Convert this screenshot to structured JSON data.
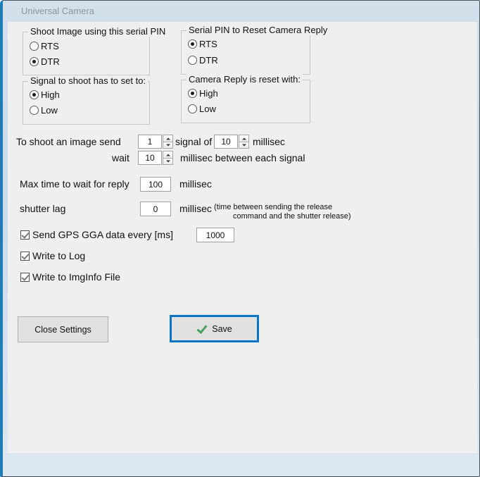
{
  "window": {
    "title": "Universal Camera"
  },
  "groups": {
    "shoot_pin": {
      "title": "Shoot Image using this serial PIN",
      "options": [
        {
          "label": "RTS",
          "selected": false
        },
        {
          "label": "DTR",
          "selected": true
        }
      ]
    },
    "reset_pin": {
      "title": "Serial PIN to Reset Camera Reply",
      "options": [
        {
          "label": "RTS",
          "selected": true
        },
        {
          "label": "DTR",
          "selected": false
        }
      ]
    },
    "signal_level": {
      "title": "Signal to shoot has to set to:",
      "options": [
        {
          "label": "High",
          "selected": true
        },
        {
          "label": "Low",
          "selected": false
        }
      ]
    },
    "reply_reset": {
      "title": "Camera Reply is reset with:",
      "options": [
        {
          "label": "High",
          "selected": true
        },
        {
          "label": "Low",
          "selected": false
        }
      ]
    }
  },
  "shoot_row": {
    "prefix_label": "To shoot an image send",
    "count_value": "1",
    "middle_label": "signal of",
    "duration_value": "10",
    "suffix_label": "millisec"
  },
  "wait_row": {
    "prefix_label": "wait",
    "value": "10",
    "suffix_label": "millisec between each signal"
  },
  "max_wait_row": {
    "label": "Max time to wait for reply",
    "value": "100",
    "unit": "millisec"
  },
  "shutter_lag_row": {
    "label": "shutter lag",
    "value": "0",
    "unit": "millisec",
    "note_line1": "(time between sending the release",
    "note_line2": "command and the shutter release)"
  },
  "checkboxes": {
    "gps": {
      "label": "Send GPS GGA data every [ms]",
      "checked": true,
      "interval_value": "1000"
    },
    "write_log": {
      "label": "Write to Log",
      "checked": true
    },
    "write_imginfo": {
      "label": "Write to ImgInfo File",
      "checked": true
    }
  },
  "buttons": {
    "close_settings": "Close Settings",
    "save": "Save"
  },
  "colors": {
    "accent_blue": "#1f7cb4",
    "focus_blue": "#0a74c6",
    "check_green": "#4aa05e",
    "client_bg": "#efeff0"
  }
}
